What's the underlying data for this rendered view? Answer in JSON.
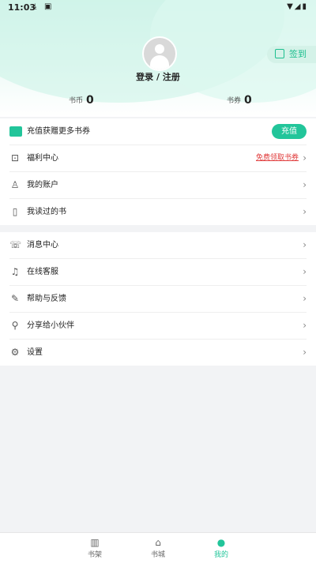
{
  "status_bar": {
    "time": "11:03",
    "icons": [
      "download-icon",
      "app-icon",
      "wifi-icon",
      "signal-icon",
      "battery-icon"
    ]
  },
  "profile": {
    "login_text": "登录 / 注册",
    "checkin_label": "签到"
  },
  "stats": {
    "coins_label": "书币",
    "coins_value": "0",
    "vouchers_label": "书券",
    "vouchers_value": "0"
  },
  "recharge_row": {
    "label": "充值获赠更多书券",
    "button": "充值"
  },
  "menu_group1": [
    {
      "label": "福利中心",
      "icon": "gift-icon",
      "promo": "免费领取书券"
    },
    {
      "label": "我的账户",
      "icon": "user-icon"
    },
    {
      "label": "我读过的书",
      "icon": "books-icon"
    }
  ],
  "menu_group2": [
    {
      "label": "消息中心",
      "icon": "message-icon"
    },
    {
      "label": "在线客服",
      "icon": "headset-icon"
    },
    {
      "label": "帮助与反馈",
      "icon": "edit-icon"
    },
    {
      "label": "分享给小伙伴",
      "icon": "share-icon"
    },
    {
      "label": "设置",
      "icon": "gear-icon"
    }
  ],
  "tabs": [
    {
      "label": "书架",
      "icon": "bookshelf-icon"
    },
    {
      "label": "书城",
      "icon": "home-icon"
    },
    {
      "label": "我的",
      "icon": "person-icon",
      "active": true
    }
  ],
  "colors": {
    "accent": "#22c59a",
    "promo": "#e03b3b"
  }
}
